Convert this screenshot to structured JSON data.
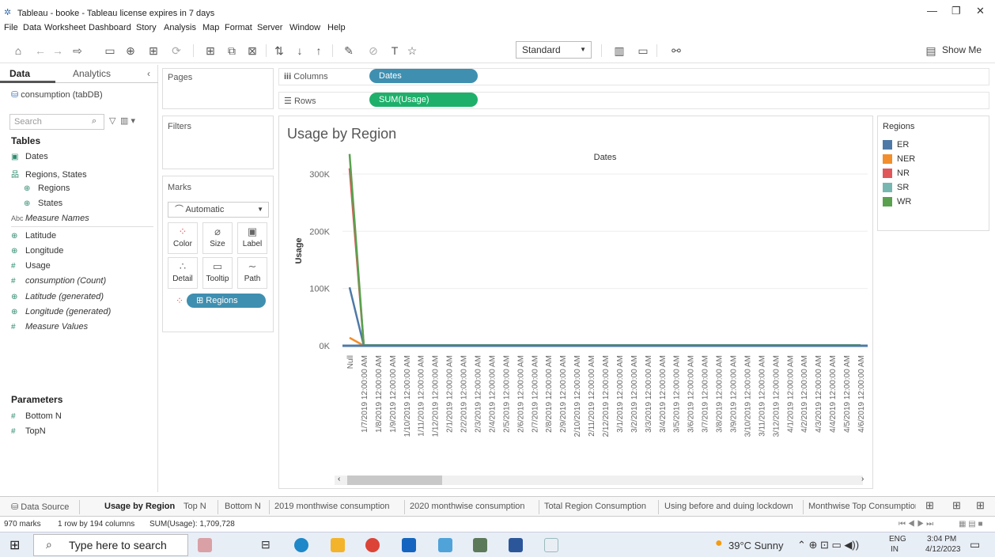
{
  "window": {
    "title": "Tableau - booke - Tableau license expires in 7 days"
  },
  "menu": [
    "File",
    "Data",
    "Worksheet",
    "Dashboard",
    "Story",
    "Analysis",
    "Map",
    "Format",
    "Server",
    "Window",
    "Help"
  ],
  "toolbar": {
    "fit_select": "Standard",
    "show_me": "Show Me"
  },
  "left_panel": {
    "tabs": [
      "Data",
      "Analytics"
    ],
    "datasource": "consumption (tabDB)",
    "search_placeholder": "Search",
    "tables_header": "Tables",
    "fields": [
      {
        "icon": "calendar-icon",
        "glyph": "▣",
        "label": "Dates",
        "italic": false
      },
      {
        "icon": "hierarchy-icon",
        "glyph": "品",
        "label": "Regions, States",
        "italic": false
      },
      {
        "icon": "globe-icon",
        "glyph": "⊕",
        "label": "Regions",
        "italic": false
      },
      {
        "icon": "globe-icon",
        "glyph": "⊕",
        "label": "States",
        "italic": false
      },
      {
        "icon": "abc-icon",
        "glyph": "Abc",
        "label": "Measure Names",
        "italic": true
      },
      {
        "icon": "globe-icon",
        "glyph": "⊕",
        "label": "Latitude",
        "italic": false
      },
      {
        "icon": "globe-icon",
        "glyph": "⊕",
        "label": "Longitude",
        "italic": false
      },
      {
        "icon": "hash-icon",
        "glyph": "#",
        "label": "Usage",
        "italic": false
      },
      {
        "icon": "hash-icon",
        "glyph": "#",
        "label": "consumption (Count)",
        "italic": true
      },
      {
        "icon": "globe-icon",
        "glyph": "⊕",
        "label": "Latitude (generated)",
        "italic": true
      },
      {
        "icon": "globe-icon",
        "glyph": "⊕",
        "label": "Longitude (generated)",
        "italic": true
      },
      {
        "icon": "hash-icon",
        "glyph": "#",
        "label": "Measure Values",
        "italic": true
      }
    ],
    "parameters_header": "Parameters",
    "parameters": [
      "Bottom N",
      "TopN"
    ]
  },
  "shelves": {
    "pages": "Pages",
    "filters": "Filters",
    "marks": "Marks",
    "mark_type": "Automatic",
    "columns_label": "Columns",
    "rows_label": "Rows",
    "columns_pill": "Dates",
    "rows_pill": "SUM(Usage)",
    "mark_buttons": [
      "Color",
      "Size",
      "Label",
      "Detail",
      "Tooltip",
      "Path"
    ],
    "color_pill": "Regions"
  },
  "sheet_title": "Usage by Region",
  "legend": {
    "title": "Regions",
    "colors": {
      "ER": "#4e79a7",
      "NER": "#f28e2b",
      "NR": "#e15759",
      "SR": "#76b7b2",
      "WR": "#59a14f"
    }
  },
  "chart_data": {
    "type": "line",
    "title": "Usage by Region",
    "xlabel": "Dates",
    "ylabel": "Usage",
    "ylim": [
      0,
      340000
    ],
    "yticks": [
      "300K",
      "200K",
      "100K",
      "0K"
    ],
    "categories": [
      "Null",
      "1/7/2019 12:00:00 AM",
      "1/8/2019 12:00:00 AM",
      "1/9/2019 12:00:00 AM",
      "1/10/2019 12:00:00 AM",
      "1/11/2019 12:00:00 AM",
      "1/12/2019 12:00:00 AM",
      "2/1/2019 12:00:00 AM",
      "2/2/2019 12:00:00 AM",
      "2/3/2019 12:00:00 AM",
      "2/4/2019 12:00:00 AM",
      "2/5/2019 12:00:00 AM",
      "2/6/2019 12:00:00 AM",
      "2/7/2019 12:00:00 AM",
      "2/8/2019 12:00:00 AM",
      "2/9/2019 12:00:00 AM",
      "2/10/2019 12:00:00 AM",
      "2/11/2019 12:00:00 AM",
      "2/12/2019 12:00:00 AM",
      "3/1/2019 12:00:00 AM",
      "3/2/2019 12:00:00 AM",
      "3/3/2019 12:00:00 AM",
      "3/4/2019 12:00:00 AM",
      "3/5/2019 12:00:00 AM",
      "3/6/2019 12:00:00 AM",
      "3/7/2019 12:00:00 AM",
      "3/8/2019 12:00:00 AM",
      "3/9/2019 12:00:00 AM",
      "3/10/2019 12:00:00 AM",
      "3/11/2019 12:00:00 AM",
      "3/12/2019 12:00:00 AM",
      "4/1/2019 12:00:00 AM",
      "4/2/2019 12:00:00 AM",
      "4/3/2019 12:00:00 AM",
      "4/4/2019 12:00:00 AM",
      "4/5/2019 12:00:00 AM",
      "4/6/2019 12:00:00 AM"
    ],
    "series": [
      {
        "name": "WR",
        "values": [
          335000,
          1000,
          1000,
          1000,
          1000,
          1000,
          1000,
          1000,
          1000,
          1000,
          1000,
          1000,
          1000,
          1000,
          1000,
          1000,
          1000,
          1000,
          1000,
          1000,
          1000,
          1000,
          1000,
          1000,
          1000,
          1000,
          1000,
          1000,
          1000,
          1000,
          1000,
          1000,
          1000,
          1000,
          1000,
          1000,
          1000
        ]
      },
      {
        "name": "NR",
        "values": [
          310000,
          1000,
          1000,
          1000,
          1000,
          1000,
          1000,
          1000,
          1000,
          1000,
          1000,
          1000,
          1000,
          1000,
          1000,
          1000,
          1000,
          1000,
          1000,
          1000,
          1000,
          1000,
          1000,
          1000,
          1000,
          1000,
          1000,
          1000,
          1000,
          1000,
          1000,
          1000,
          1000,
          1000,
          1000,
          1000,
          1000
        ]
      },
      {
        "name": "ER",
        "values": [
          102000,
          500,
          500,
          500,
          500,
          500,
          500,
          500,
          500,
          500,
          500,
          500,
          500,
          500,
          500,
          500,
          500,
          500,
          500,
          500,
          500,
          500,
          500,
          500,
          500,
          500,
          500,
          500,
          500,
          500,
          500,
          500,
          500,
          500,
          500,
          500,
          500
        ]
      },
      {
        "name": "NER",
        "values": [
          14000,
          200,
          200,
          200,
          200,
          200,
          200,
          200,
          200,
          200,
          200,
          200,
          200,
          200,
          200,
          200,
          200,
          200,
          200,
          200,
          200,
          200,
          200,
          200,
          200,
          200,
          200,
          200,
          200,
          200,
          200,
          200,
          200,
          200,
          200,
          200,
          200
        ]
      },
      {
        "name": "SR",
        "values": [
          0,
          800,
          800,
          800,
          800,
          800,
          800,
          800,
          800,
          800,
          800,
          800,
          800,
          800,
          800,
          800,
          800,
          800,
          800,
          800,
          800,
          800,
          800,
          800,
          800,
          800,
          800,
          800,
          800,
          800,
          800,
          800,
          800,
          800,
          800,
          800,
          800
        ]
      }
    ]
  },
  "sheet_tabs": [
    "Data Source",
    "Usage by Region",
    "Top N",
    "Bottom N",
    "2019 monthwise consumption",
    "2020 monthwise consumption",
    "Total Region Consumption",
    "Using before and duing lockdown",
    "Monthwise Top Consumptior"
  ],
  "status": {
    "marks": "970 marks",
    "rows": "1 row by 194 columns",
    "sum": "SUM(Usage): 1,709,728"
  },
  "taskbar": {
    "search": "Type here to search",
    "weather": "39°C  Sunny",
    "lang1": "ENG",
    "lang2": "IN",
    "time": "3:04 PM",
    "date": "4/12/2023"
  }
}
